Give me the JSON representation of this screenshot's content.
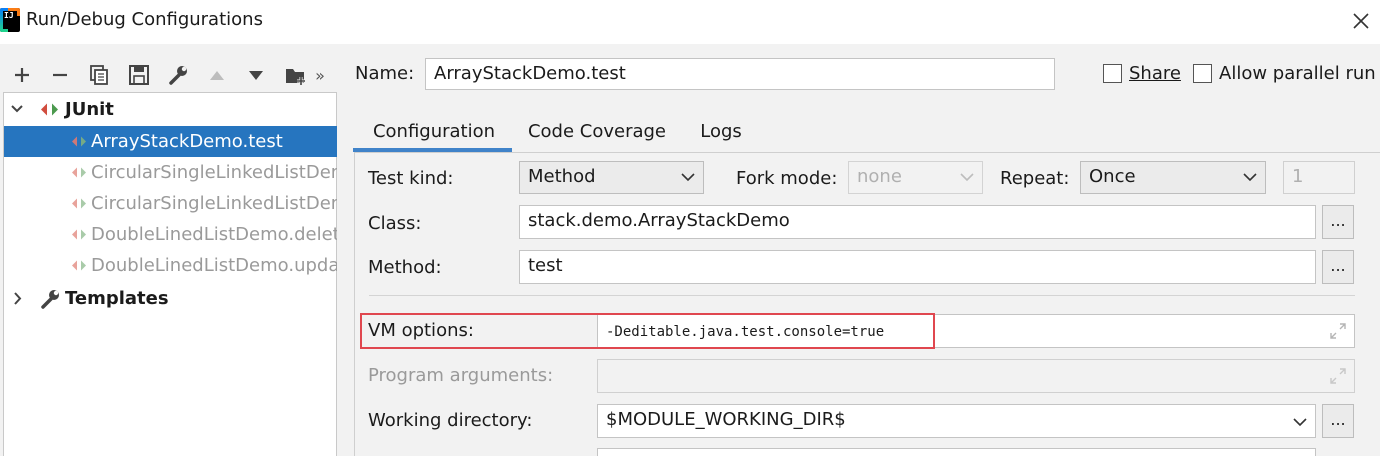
{
  "window": {
    "title": "Run/Debug Configurations",
    "app_icon_text": "IJ"
  },
  "toolbar": {
    "buttons": [
      "add-icon",
      "remove-icon",
      "copy-icon",
      "save-icon",
      "wrench-icon",
      "move-up-icon",
      "move-down-icon",
      "new-folder-icon",
      "more-icon"
    ],
    "more_label": "»"
  },
  "tree": {
    "junit": {
      "label": "JUnit",
      "expanded": true,
      "items": [
        {
          "label": "ArrayStackDemo.test",
          "selected": true
        },
        {
          "label": "CircularSingleLinkedListDemo",
          "selected": false
        },
        {
          "label": "CircularSingleLinkedListDemo",
          "selected": false
        },
        {
          "label": "DoubleLinedListDemo.delete",
          "selected": false
        },
        {
          "label": "DoubleLinedListDemo.update",
          "selected": false
        }
      ]
    },
    "templates": {
      "label": "Templates",
      "expanded": false
    }
  },
  "header": {
    "name_label": "Name:",
    "name_value": "ArrayStackDemo.test",
    "share_label": "Share",
    "share_checked": false,
    "parallel_label": "Allow parallel run",
    "parallel_checked": false
  },
  "tabs": [
    {
      "label": "Configuration",
      "active": true
    },
    {
      "label": "Code Coverage",
      "active": false
    },
    {
      "label": "Logs",
      "active": false
    }
  ],
  "config": {
    "test_kind_label": "Test kind:",
    "test_kind_value": "Method",
    "fork_mode_label": "Fork mode:",
    "fork_mode_value": "none",
    "repeat_label": "Repeat:",
    "repeat_value": "Once",
    "repeat_count": "1",
    "class_label": "Class:",
    "class_value": "stack.demo.ArrayStackDemo",
    "method_label": "Method:",
    "method_value": "test",
    "browse_label": "...",
    "vm_options_label": "VM options:",
    "vm_options_value": "-Deditable.java.test.console=true",
    "program_args_label": "Program arguments:",
    "program_args_value": "",
    "working_dir_label": "Working directory:",
    "working_dir_value": "$MODULE_WORKING_DIR$"
  },
  "colors": {
    "selection": "#2675bf",
    "tab_underline": "#4083c9",
    "highlight_box": "#e0474f",
    "panel_bg": "#f2f2f2"
  }
}
